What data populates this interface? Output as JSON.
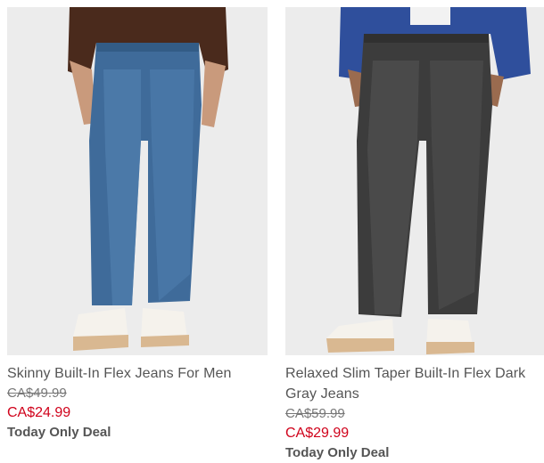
{
  "products": [
    {
      "title": "Skinny Built-In Flex Jeans For Men",
      "original_price": "CA$49.99",
      "sale_price": "CA$24.99",
      "deal_label": "Today Only Deal",
      "image_icon": "jeans-product-photo"
    },
    {
      "title": "Relaxed Slim Taper Built-In Flex Dark Gray Jeans",
      "original_price": "CA$59.99",
      "sale_price": "CA$29.99",
      "deal_label": "Today Only Deal",
      "image_icon": "jeans-product-photo"
    }
  ],
  "colors": {
    "sale_price": "#d0021b",
    "text": "#555555",
    "photo_bg": "#ececec",
    "denim_blue": "#3f6b9a",
    "denim_gray": "#3c3c3c"
  }
}
